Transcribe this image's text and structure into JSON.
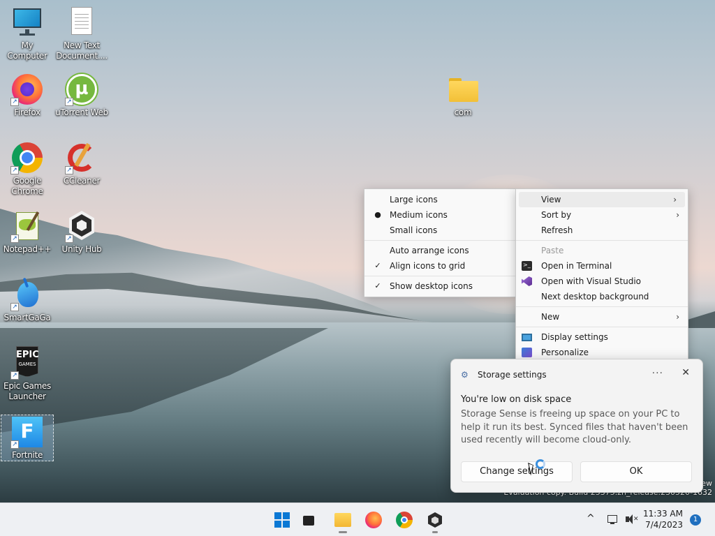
{
  "desktop": {
    "icons": [
      {
        "label": "My Computer"
      },
      {
        "label": "New Text Document...."
      },
      {
        "label": "Firefox"
      },
      {
        "label": "uTorrent Web"
      },
      {
        "label": "Google Chrome"
      },
      {
        "label": "CCleaner"
      },
      {
        "label": "Notepad++"
      },
      {
        "label": "Unity Hub"
      },
      {
        "label": "SmartGaGa"
      },
      {
        "label": "Epic Games Launcher"
      },
      {
        "label": "Fortnite"
      },
      {
        "label": "com"
      }
    ],
    "epic_logo_text": "EPIC",
    "epic_logo_sub": "GAMES",
    "fortnite_logo": "F"
  },
  "view_submenu": {
    "items": [
      {
        "label": "Large icons"
      },
      {
        "label": "Medium icons",
        "mark": "●"
      },
      {
        "label": "Small icons"
      },
      {
        "label": "Auto arrange icons"
      },
      {
        "label": "Align icons to grid",
        "mark": "✓"
      },
      {
        "label": "Show desktop icons",
        "mark": "✓"
      }
    ]
  },
  "context_menu": {
    "items": [
      {
        "label": "View"
      },
      {
        "label": "Sort by"
      },
      {
        "label": "Refresh"
      },
      {
        "label": "Paste"
      },
      {
        "label": "Open in Terminal"
      },
      {
        "label": "Open with Visual Studio"
      },
      {
        "label": "Next desktop background"
      },
      {
        "label": "New"
      },
      {
        "label": "Display settings"
      },
      {
        "label": "Personalize"
      }
    ],
    "chevron": "›"
  },
  "notification": {
    "app_name": "Storage settings",
    "more": "···",
    "close": "✕",
    "title": "You're low on disk space",
    "body": "Storage Sense is freeing up space on your PC to help it run its best. Synced files that haven't been used recently will become cloud-only.",
    "primary_button": "Change settings",
    "secondary_button": "OK"
  },
  "watermark": {
    "line1": "ew",
    "line2": "Evaluation copy. Build 25375.zn_release.230520-1632"
  },
  "taskbar": {
    "time": "11:33 AM",
    "date": "7/4/2023",
    "notification_count": "1",
    "chevron": "^"
  }
}
